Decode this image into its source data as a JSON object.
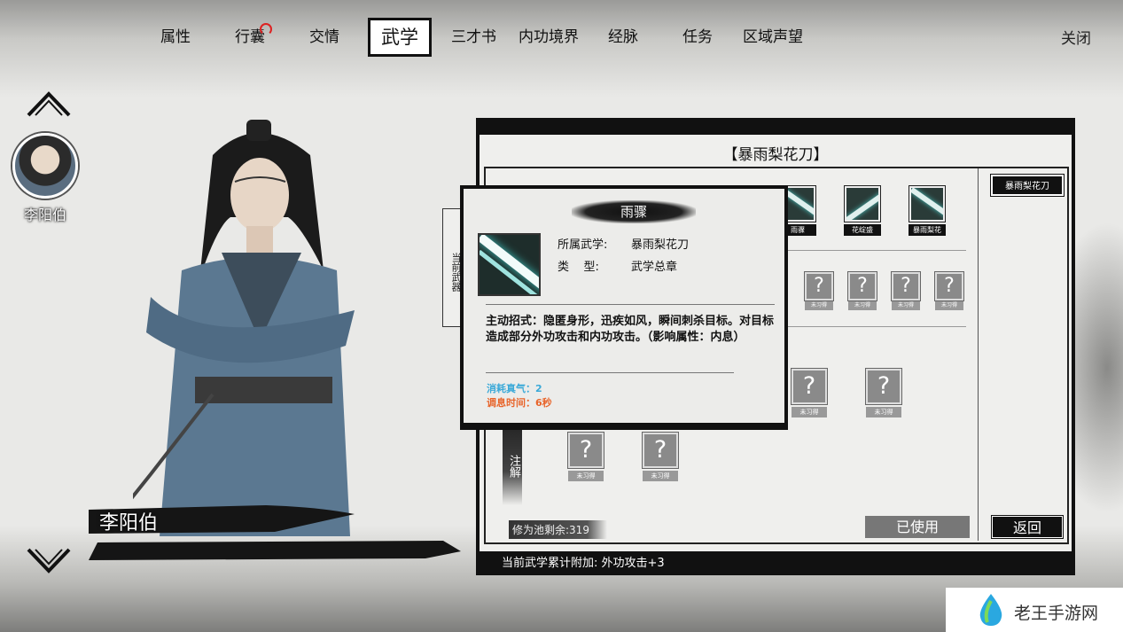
{
  "nav": {
    "tabs": [
      {
        "label": "属性"
      },
      {
        "label": "行囊"
      },
      {
        "label": "交情"
      },
      {
        "label": "武学",
        "active": true
      },
      {
        "label": "三才书"
      },
      {
        "label": "内功境界"
      },
      {
        "label": "经脉"
      },
      {
        "label": "任务"
      },
      {
        "label": "区域声望"
      }
    ],
    "close_label": "关闭"
  },
  "character": {
    "avatar_name": "李阳伯",
    "banner_name": "李阳伯"
  },
  "panel": {
    "title": "【暴雨梨花刀】",
    "right_tab_label": "暴雨梨花刀",
    "side_tab_label": "当前武器",
    "annotation_label": "注解",
    "learned_skills": [
      {
        "label": "雨骤"
      },
      {
        "label": "花绽盛"
      },
      {
        "label": "暴雨梨花"
      }
    ],
    "locked_label": "未习得",
    "locked_glyph": "?",
    "pool_text": "修为池剩余:319",
    "used_button": "已使用",
    "back_button": "返回",
    "bonus_text": "当前武学累计附加: 外功攻击+3"
  },
  "tooltip": {
    "name": "雨骤",
    "martial_art_label": "所属武学:",
    "martial_art_value": "暴雨梨花刀",
    "type_label": "类    型:",
    "type_value": "武学总章",
    "description": "主动招式：隐匿身形，迅疾如风，瞬间刺杀目标。对目标造成部分外功攻击和内功攻击。（影响属性：内息）",
    "cost": "消耗真气：2",
    "cooldown": "调息时间：6秒"
  },
  "watermark": {
    "text": "老王手游网"
  },
  "colors": {
    "cost": "#3aa9d8",
    "cooldown": "#e8642a",
    "skill_glow": "#4ec5c0",
    "notify": "#dd2222"
  }
}
